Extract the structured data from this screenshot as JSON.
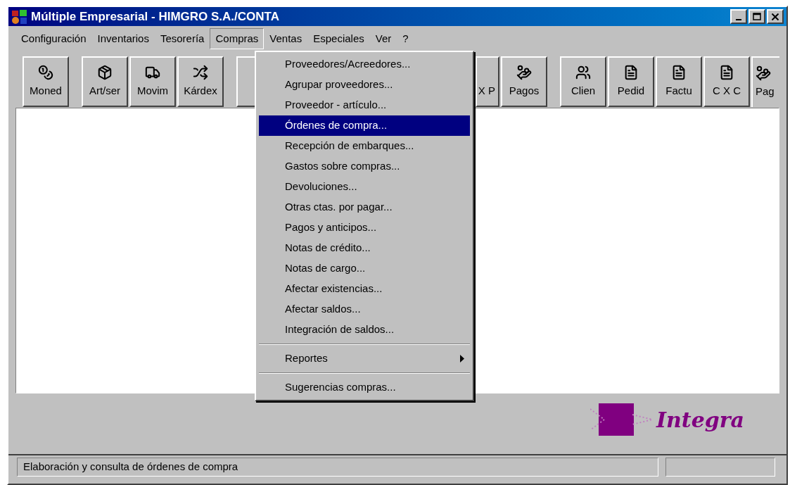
{
  "window": {
    "title": "Múltiple Empresarial - HIMGRO S.A./CONTA"
  },
  "menu_bar": [
    {
      "label": "Configuración",
      "selected": false
    },
    {
      "label": "Inventarios",
      "selected": false
    },
    {
      "label": "Tesorería",
      "selected": false
    },
    {
      "label": "Compras",
      "selected": true
    },
    {
      "label": "Ventas",
      "selected": false
    },
    {
      "label": "Especiales",
      "selected": false
    },
    {
      "label": "Ver",
      "selected": false
    },
    {
      "label": "?",
      "selected": false
    }
  ],
  "toolbar": [
    {
      "kind": "button",
      "label": "Moned",
      "group_start": true
    },
    {
      "kind": "button",
      "label": "Art/ser",
      "group_start": true
    },
    {
      "kind": "button",
      "label": "Movim",
      "group_start": false
    },
    {
      "kind": "button",
      "label": "Kárdex",
      "group_start": false
    },
    {
      "kind": "stub",
      "group_start": true
    },
    {
      "kind": "partial",
      "label": "X P",
      "group_start": false
    },
    {
      "kind": "button",
      "label": "Pagos",
      "group_start": false
    },
    {
      "kind": "button",
      "label": "Clien",
      "group_start": true
    },
    {
      "kind": "button",
      "label": "Pedid",
      "group_start": false
    },
    {
      "kind": "button",
      "label": "Factu",
      "group_start": false
    },
    {
      "kind": "button",
      "label": "C X C",
      "group_start": false
    },
    {
      "kind": "clipped",
      "label": "Pag",
      "group_start": false
    }
  ],
  "dropdown_menu": [
    {
      "kind": "item",
      "label": "Proveedores/Acreedores...",
      "selected": false
    },
    {
      "kind": "item",
      "label": "Agrupar proveedores...",
      "selected": false
    },
    {
      "kind": "item",
      "label": "Proveedor - artículo...",
      "selected": false
    },
    {
      "kind": "item",
      "label": "Órdenes de compra...",
      "selected": true
    },
    {
      "kind": "item",
      "label": "Recepción de embarques...",
      "selected": false
    },
    {
      "kind": "item",
      "label": "Gastos sobre compras...",
      "selected": false
    },
    {
      "kind": "item",
      "label": "Devoluciones...",
      "selected": false
    },
    {
      "kind": "item",
      "label": "Otras ctas. por pagar...",
      "selected": false
    },
    {
      "kind": "item",
      "label": "Pagos y anticipos...",
      "selected": false
    },
    {
      "kind": "item",
      "label": "Notas de crédito...",
      "selected": false
    },
    {
      "kind": "item",
      "label": "Notas de cargo...",
      "selected": false
    },
    {
      "kind": "item",
      "label": "Afectar existencias...",
      "selected": false
    },
    {
      "kind": "item",
      "label": "Afectar saldos...",
      "selected": false
    },
    {
      "kind": "item",
      "label": "Integración de saldos...",
      "selected": false
    },
    {
      "kind": "separator"
    },
    {
      "kind": "submenu",
      "label": "Reportes",
      "selected": false
    },
    {
      "kind": "separator"
    },
    {
      "kind": "item",
      "label": "Sugerencias compras...",
      "selected": false
    }
  ],
  "logo": {
    "text": "Integra"
  },
  "status_bar": {
    "message": "Elaboración y consulta de órdenes de compra"
  }
}
